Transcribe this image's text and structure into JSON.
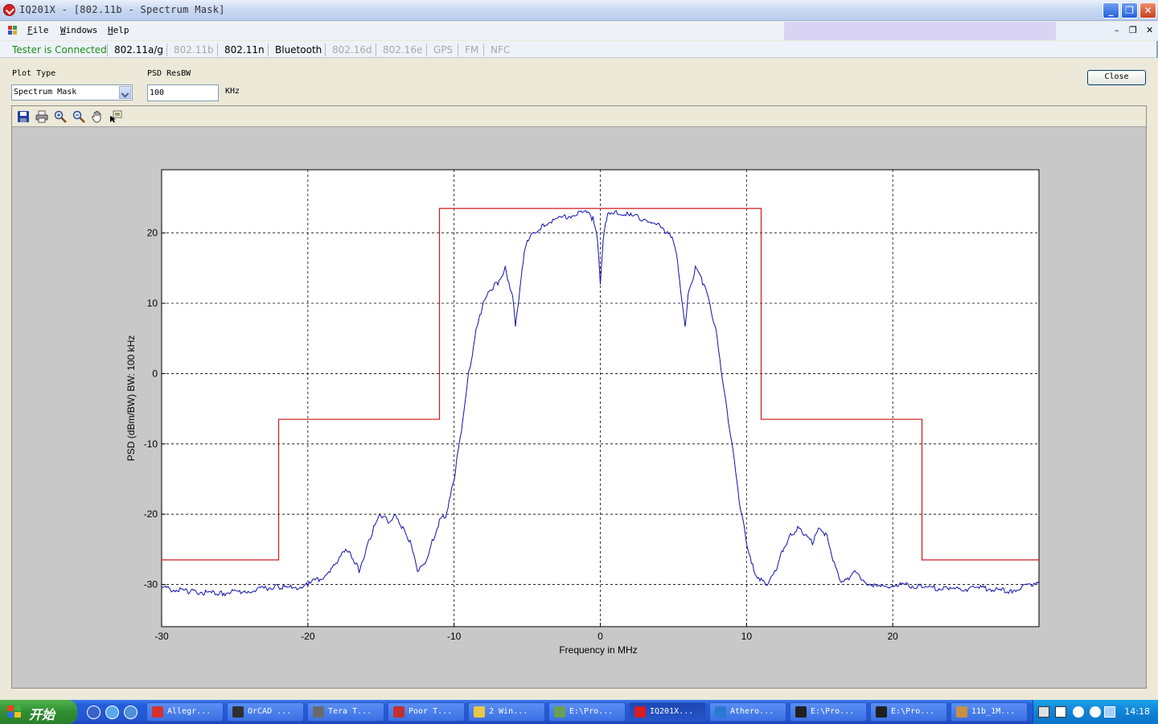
{
  "window": {
    "title": "IQ201X - [802.11b - Spectrum Mask]"
  },
  "menu": {
    "items": [
      {
        "label": "File",
        "accel": "F",
        "rest": "ile"
      },
      {
        "label": "Windows",
        "accel": "W",
        "rest": "indows"
      },
      {
        "label": "Help",
        "accel": "H",
        "rest": "elp"
      }
    ]
  },
  "tabbar": {
    "status": "Tester is Connected",
    "status_color": "#1c8e1c",
    "tabs": [
      {
        "label": "802.11a/g",
        "enabled": true
      },
      {
        "label": "802.11b",
        "enabled": false
      },
      {
        "label": "802.11n",
        "enabled": true
      },
      {
        "label": "Bluetooth",
        "enabled": true
      },
      {
        "label": "802.16d",
        "enabled": false
      },
      {
        "label": "802.16e",
        "enabled": false
      },
      {
        "label": "GPS",
        "enabled": false
      },
      {
        "label": "FM",
        "enabled": false
      },
      {
        "label": "NFC",
        "enabled": false
      }
    ]
  },
  "controls": {
    "plot_type_label": "Plot Type",
    "plot_type_value": "Spectrum Mask",
    "psd_resbw_label": "PSD ResBW",
    "psd_resbw_value": "100",
    "psd_resbw_unit": "KHz",
    "close_label": "Close"
  },
  "toolbar_icons": [
    "save-icon",
    "print-icon",
    "zoom-in-icon",
    "zoom-out-icon",
    "pan-hand-icon",
    "data-cursor-icon"
  ],
  "chart_data": {
    "type": "line",
    "title": "",
    "xlabel": "Frequency in MHz",
    "ylabel": "PSD (dBm/BW) BW: 100 kHz",
    "xlim": [
      -30,
      30
    ],
    "ylim": [
      -36,
      29
    ],
    "xticks": [
      -30,
      -20,
      -10,
      0,
      10,
      20
    ],
    "yticks": [
      -30,
      -20,
      -10,
      0,
      10,
      20
    ],
    "grid": true,
    "grid_style": "dashed",
    "series": [
      {
        "color": "#d01818",
        "x": [
          -30,
          -22,
          -22,
          -11,
          -11,
          11,
          11,
          22,
          22,
          30
        ],
        "y": [
          -26.5,
          -26.5,
          -6.5,
          -6.5,
          23.5,
          23.5,
          -6.5,
          -6.5,
          -26.5,
          -26.5
        ]
      },
      {
        "color": "#1010b0",
        "x": [
          -30,
          -28,
          -26,
          -24,
          -22,
          -21,
          -20,
          -19,
          -18,
          -17.5,
          -17,
          -16.5,
          -16,
          -15.5,
          -15,
          -14.5,
          -14,
          -13.5,
          -13,
          -12.5,
          -12,
          -11.5,
          -11,
          -10.5,
          -10,
          -9.5,
          -9,
          -8.5,
          -8,
          -7.5,
          -7,
          -6.5,
          -6,
          -5.8,
          -5.5,
          -5.2,
          -5,
          -4.5,
          -4,
          -3,
          -2,
          -1,
          -0.5,
          -0.2,
          0,
          0.2,
          0.5,
          1,
          2,
          3,
          4,
          4.5,
          5,
          5.2,
          5.5,
          5.8,
          6,
          6.5,
          7,
          7.5,
          8,
          8.5,
          9,
          9.5,
          10,
          10.5,
          11,
          11.5,
          12,
          12.5,
          13,
          13.5,
          14,
          14.5,
          15,
          15.5,
          16,
          16.5,
          17,
          17.5,
          18,
          19,
          20,
          22,
          24,
          26,
          28,
          30
        ],
        "y": [
          -30.5,
          -31,
          -31.3,
          -30.8,
          -30.3,
          -30.5,
          -30,
          -29,
          -27,
          -25,
          -26,
          -28,
          -25,
          -22,
          -20,
          -21,
          -20,
          -22,
          -24,
          -28,
          -27,
          -24,
          -21,
          -20,
          -15,
          -8,
          0,
          6,
          10,
          12,
          13,
          15,
          11,
          7,
          12,
          17,
          19,
          20,
          21,
          22,
          22.5,
          23,
          22,
          19,
          13,
          19,
          23,
          23,
          22.5,
          22,
          21,
          20,
          19,
          17,
          12,
          7,
          11,
          15,
          13,
          10,
          5,
          -3,
          -10,
          -18,
          -24,
          -28,
          -29.5,
          -30,
          -28,
          -25,
          -23,
          -22,
          -23,
          -24,
          -22,
          -23,
          -27,
          -30,
          -29,
          -28,
          -29.5,
          -30.5,
          -30,
          -30.3,
          -30.8,
          -30.5,
          -31,
          -29.5
        ]
      }
    ]
  },
  "taskbar": {
    "start_label": "开始",
    "tasks": [
      {
        "label": "Allegr...",
        "icon_color": "#d8302c",
        "active": false
      },
      {
        "label": "OrCAD ...",
        "icon_color": "#303030",
        "active": false
      },
      {
        "label": "Tera T...",
        "icon_color": "#6a6a6a",
        "active": false
      },
      {
        "label": "Poor T...",
        "icon_color": "#c03030",
        "active": false
      },
      {
        "label": "2 Win...",
        "icon_color": "#e8c848",
        "active": false
      },
      {
        "label": "E:\\Pro...",
        "icon_color": "#6aa050",
        "active": false
      },
      {
        "label": "IQ201X...",
        "icon_color": "#d81e1e",
        "active": true
      },
      {
        "label": "Athero...",
        "icon_color": "#2a7ad0",
        "active": false
      },
      {
        "label": "E:\\Pro...",
        "icon_color": "#202020",
        "active": false
      },
      {
        "label": "E:\\Pro...",
        "icon_color": "#202020",
        "active": false
      },
      {
        "label": "11b_1M...",
        "icon_color": "#c89040",
        "active": false
      }
    ],
    "clock": "14:18"
  }
}
